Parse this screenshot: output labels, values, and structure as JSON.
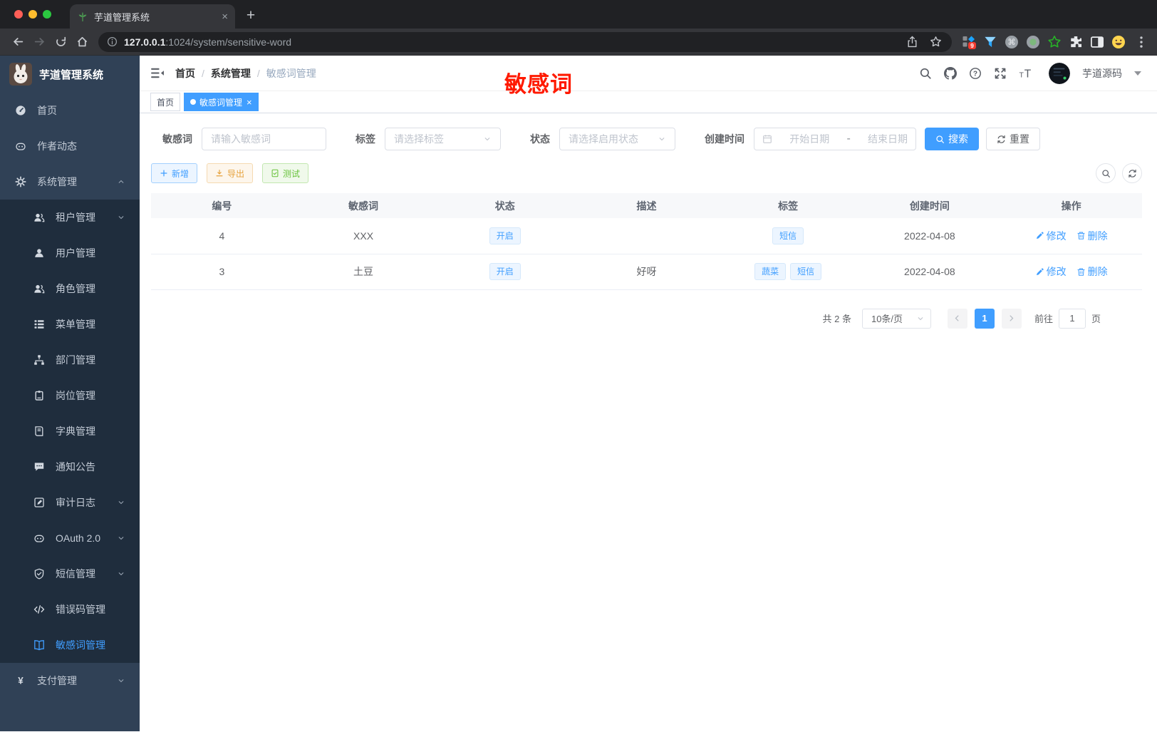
{
  "browser": {
    "tab_title": "芋道管理系统",
    "url_host": "127.0.0.1",
    "url_rest": ":1024/system/sensitive-word",
    "ext_badge": "9"
  },
  "sidebar": {
    "logo_title": "芋道管理系统",
    "items": [
      {
        "key": "home",
        "icon": "gauge",
        "label": "首页",
        "level": 1
      },
      {
        "key": "author",
        "icon": "robot",
        "label": "作者动态",
        "level": 1
      },
      {
        "key": "system",
        "icon": "gear",
        "label": "系统管理",
        "level": 1,
        "chevron": "up"
      },
      {
        "key": "tenant",
        "icon": "users",
        "label": "租户管理",
        "level": 2,
        "chevron": "down"
      },
      {
        "key": "user",
        "icon": "user",
        "label": "用户管理",
        "level": 2
      },
      {
        "key": "role",
        "icon": "users",
        "label": "角色管理",
        "level": 2
      },
      {
        "key": "menu",
        "icon": "tree",
        "label": "菜单管理",
        "level": 2
      },
      {
        "key": "dept",
        "icon": "org",
        "label": "部门管理",
        "level": 2
      },
      {
        "key": "post",
        "icon": "badge",
        "label": "岗位管理",
        "level": 2
      },
      {
        "key": "dict",
        "icon": "book",
        "label": "字典管理",
        "level": 2
      },
      {
        "key": "notice",
        "icon": "chat",
        "label": "通知公告",
        "level": 2
      },
      {
        "key": "audit",
        "icon": "editlog",
        "label": "审计日志",
        "level": 2,
        "chevron": "down"
      },
      {
        "key": "oauth",
        "icon": "robot",
        "label": "OAuth 2.0",
        "level": 2,
        "chevron": "down"
      },
      {
        "key": "sms",
        "icon": "shield",
        "label": "短信管理",
        "level": 2,
        "chevron": "down"
      },
      {
        "key": "errcode",
        "icon": "code",
        "label": "错误码管理",
        "level": 2
      },
      {
        "key": "sensitive-word",
        "icon": "openbook",
        "label": "敏感词管理",
        "level": 2,
        "active": true
      },
      {
        "key": "pay",
        "icon": "yen",
        "label": "支付管理",
        "level": 1,
        "chevron": "down"
      }
    ]
  },
  "header": {
    "breadcrumb": [
      "首页",
      "系统管理",
      "敏感词管理"
    ],
    "breadcrumb_sep": "/",
    "annotation": "敏感词",
    "username": "芋道源码"
  },
  "tags_view": [
    {
      "label": "首页",
      "active": false,
      "closable": false
    },
    {
      "label": "敏感词管理",
      "active": true,
      "closable": true
    }
  ],
  "filters": {
    "word": {
      "label": "敏感词",
      "placeholder": "请输入敏感词"
    },
    "tag": {
      "label": "标签",
      "placeholder": "请选择标签"
    },
    "status": {
      "label": "状态",
      "placeholder": "请选择启用状态"
    },
    "date": {
      "label": "创建时间",
      "start": "开始日期",
      "sep": "-",
      "end": "结束日期"
    },
    "search": "搜索",
    "reset": "重置"
  },
  "actions": {
    "add": "新增",
    "export": "导出",
    "test": "测试"
  },
  "table": {
    "columns": [
      "编号",
      "敏感词",
      "状态",
      "描述",
      "标签",
      "创建时间",
      "操作"
    ],
    "rows": [
      {
        "id": "4",
        "word": "XXX",
        "status": "开启",
        "desc": "",
        "tags": [
          "短信"
        ],
        "created": "2022-04-08"
      },
      {
        "id": "3",
        "word": "土豆",
        "status": "开启",
        "desc": "好呀",
        "tags": [
          "蔬菜",
          "短信"
        ],
        "created": "2022-04-08"
      }
    ],
    "edit_label": "修改",
    "delete_label": "删除"
  },
  "pagination": {
    "total": "共 2 条",
    "size": "10条/页",
    "page": "1",
    "goto": "前往",
    "goto_value": "1",
    "page_unit": "页"
  },
  "colors": {
    "accent": "#409eff",
    "annotation": "#ff1a00",
    "warning": "#e6a23c",
    "success": "#67c23a",
    "sidebar_bg": "#304156",
    "submenu_bg": "#1f2d3d"
  }
}
